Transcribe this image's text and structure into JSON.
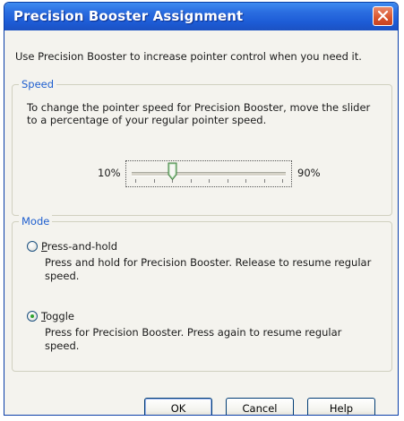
{
  "window": {
    "title": "Precision Booster Assignment",
    "close_icon": "close-x-icon"
  },
  "intro_text": "Use Precision Booster to increase pointer control when you need it.",
  "speed": {
    "legend": "Speed",
    "description": "To change the pointer speed for Precision Booster, move the slider to a percentage of your regular pointer speed.",
    "min_label": "10%",
    "max_label": "90%",
    "slider_value_fraction": 0.25,
    "tick_count": 9
  },
  "mode": {
    "legend": "Mode",
    "selected": "toggle",
    "options": [
      {
        "id": "press-and-hold",
        "label_underlined": "P",
        "label_rest": "ress-and-hold",
        "description": "Press and hold for Precision Booster. Release to resume regular speed."
      },
      {
        "id": "toggle",
        "label_underlined": "T",
        "label_rest": "oggle",
        "description": "Press for Precision Booster. Press again to resume regular speed."
      }
    ]
  },
  "buttons": {
    "ok": "OK",
    "cancel": "Cancel",
    "help": "Help"
  },
  "colors": {
    "title_bar": "#1d5cd6",
    "group_legend": "#1f5fcf",
    "close_button": "#d8542c",
    "radio_dot": "#2fa22f"
  }
}
